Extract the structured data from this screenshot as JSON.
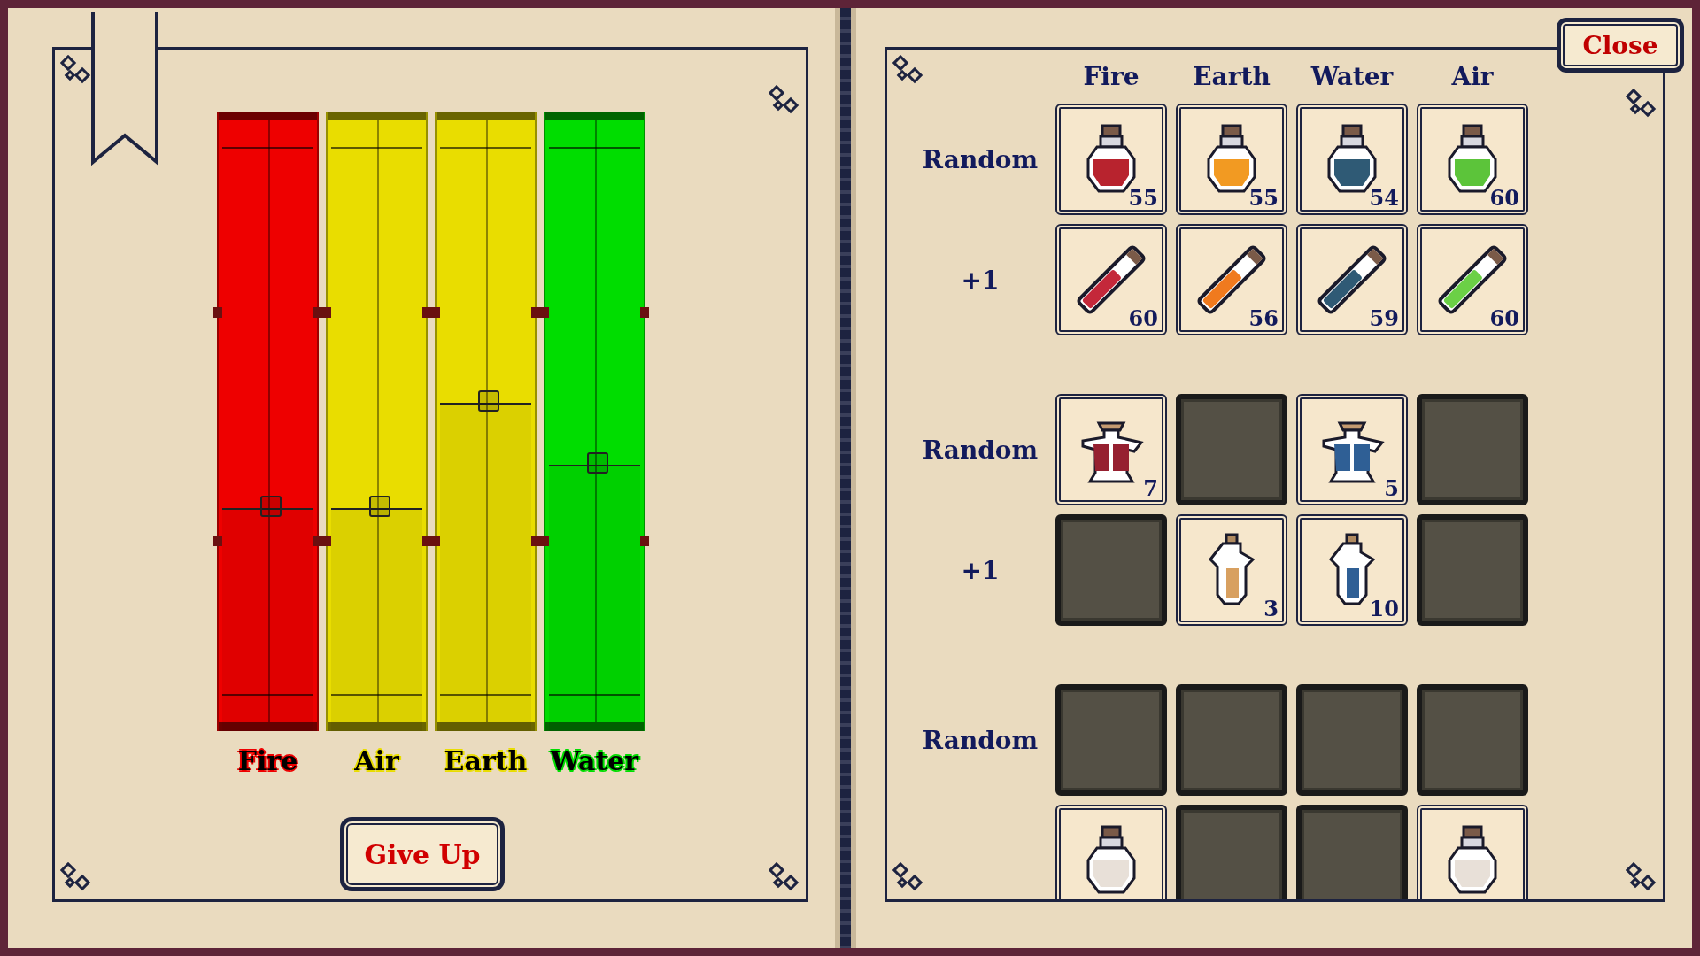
{
  "bars": [
    {
      "label": "Fire",
      "color": "#ee0000",
      "level": 0.36
    },
    {
      "label": "Air",
      "color": "#e9dd00",
      "level": 0.36
    },
    {
      "label": "Earth",
      "color": "#e9dd00",
      "level": 0.53
    },
    {
      "label": "Water",
      "color": "#00dd00",
      "level": 0.43
    }
  ],
  "give_up_button": "Give Up",
  "close_button": "Close",
  "columns": [
    "Fire",
    "Earth",
    "Water",
    "Air"
  ],
  "groups": [
    {
      "rows": [
        {
          "label": "Random",
          "cells": [
            {
              "kind": "round",
              "color": "#b8232e",
              "count": "55"
            },
            {
              "kind": "round",
              "color": "#f29a22",
              "count": "55"
            },
            {
              "kind": "round",
              "color": "#2f5a75",
              "count": "54"
            },
            {
              "kind": "round",
              "color": "#5cc43a",
              "count": "60"
            }
          ]
        },
        {
          "label": "+1",
          "cells": [
            {
              "kind": "tube",
              "color": "#c4283a",
              "count": "60"
            },
            {
              "kind": "tube",
              "color": "#f07a1e",
              "count": "56"
            },
            {
              "kind": "tube",
              "color": "#2f5a75",
              "count": "59"
            },
            {
              "kind": "tube",
              "color": "#6bd046",
              "count": "60"
            }
          ]
        }
      ]
    },
    {
      "rows": [
        {
          "label": "Random",
          "cells": [
            {
              "kind": "flask",
              "color": "#962030",
              "count": "7"
            },
            {
              "kind": "empty"
            },
            {
              "kind": "flask",
              "color": "#2f5f95",
              "count": "5"
            },
            {
              "kind": "empty"
            }
          ]
        },
        {
          "label": "+1",
          "cells": [
            {
              "kind": "empty"
            },
            {
              "kind": "vial",
              "color": "#d8a060",
              "count": "3"
            },
            {
              "kind": "vial",
              "color": "#2f5f95",
              "count": "10"
            },
            {
              "kind": "empty"
            }
          ]
        }
      ]
    },
    {
      "rows": [
        {
          "label": "Random",
          "cells": [
            {
              "kind": "empty"
            },
            {
              "kind": "empty"
            },
            {
              "kind": "empty"
            },
            {
              "kind": "empty"
            }
          ]
        },
        {
          "cells": [
            {
              "kind": "round",
              "color": "#e8e0d8"
            },
            {
              "kind": "empty"
            },
            {
              "kind": "empty"
            },
            {
              "kind": "round",
              "color": "#e8e0d8"
            }
          ]
        }
      ]
    }
  ]
}
